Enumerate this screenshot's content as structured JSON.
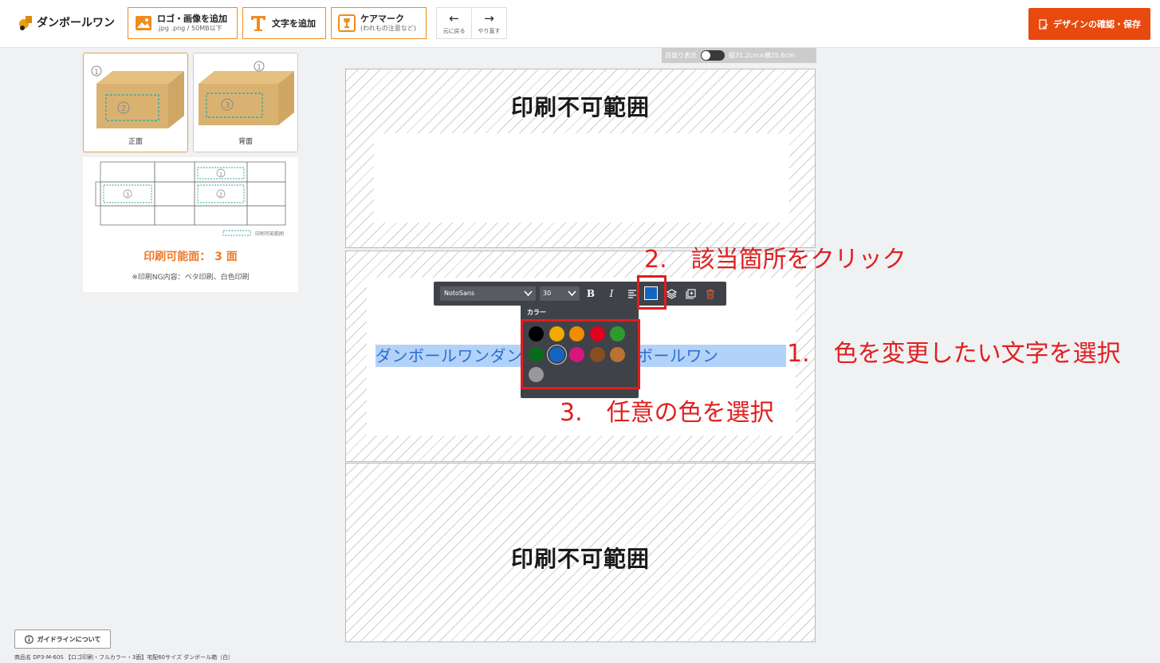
{
  "header": {
    "logo_text": "ダンボールワン",
    "logo_btn_title": "ロゴ・画像を追加",
    "logo_btn_sub": ".jpg .png / 50MB以下",
    "text_btn_title": "文字を追加",
    "care_btn_title": "ケアマーク",
    "care_btn_sub": "(われもの注意など)",
    "undo_label": "元に戻る",
    "redo_label": "やり直す",
    "save_label": "デザインの確認・保存"
  },
  "sidebar": {
    "thumbs": [
      {
        "label": "正面",
        "active": true
      },
      {
        "label": "背面",
        "active": false
      }
    ],
    "legend": "印刷可能範囲",
    "faces": "印刷可能面： 3 面",
    "ng_note": "※印刷NG内容：ベタ印刷、白色印刷"
  },
  "canvas": {
    "ruler_label": "目盛り表示",
    "size_label": "縦31.2cm×横25.6cm",
    "top_nonprint": "印刷不可範囲",
    "bottom_nonprint": "印刷不可範囲",
    "selected_text": "ダンボールワンダンボールワンダンボールワン"
  },
  "text_toolbar": {
    "font": "NotoSans",
    "size": "30",
    "bold": "B",
    "italic": "I",
    "current_color": "#1565c0"
  },
  "color_popup": {
    "title": "カラー",
    "colors": [
      "#000000",
      "#f2a900",
      "#f08c00",
      "#e2001a",
      "#2e9b2e",
      "#0a6b1e",
      "#1565c0",
      "#d6157f",
      "#8a4d1f",
      "#b87333",
      "#999999"
    ],
    "selected": "#1565c0"
  },
  "annotations": {
    "step1": "1.　色を変更したい文字を選択",
    "step2": "2.　該当箇所をクリック",
    "step3": "3.　任意の色を選択"
  },
  "footer": {
    "guide_label": "ガイドラインについて",
    "product_name": "商品名 DP3-M-60S 【ロゴ印刷・フルカラー・3面】宅配60サイズ ダンボール箱（白）"
  }
}
